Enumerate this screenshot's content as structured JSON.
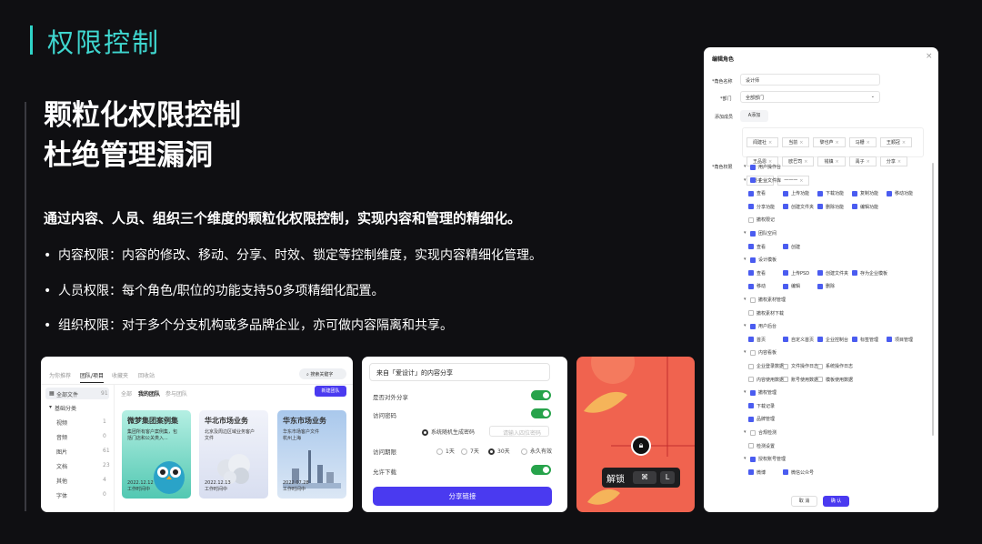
{
  "header": "权限控制",
  "headline": [
    "颗粒化权限控制",
    "杜绝管理漏洞"
  ],
  "intro": "通过内容、人员、组织三个维度的颗粒化权限控制，实现内容和管理的精细化。",
  "bullets": [
    "内容权限：内容的修改、移动、分享、时效、锁定等控制维度，实现内容精细化管理。",
    "人员权限：每个角色/职位的功能支持50多项精细化配置。",
    "组织权限：对于多个分支机构或多品牌企业，亦可做内容隔离和共享。"
  ],
  "bullet_dot": "•",
  "lib": {
    "tabs": [
      "为你推荐",
      "团队/项目",
      "收藏夹",
      "回收站"
    ],
    "search": "搜索关键字",
    "btn": "新建团队",
    "all": "全部文件",
    "all_count": "91",
    "tree_title": "基础分类",
    "tree": [
      {
        "l": "视频",
        "n": "1"
      },
      {
        "l": "音频",
        "n": "0"
      },
      {
        "l": "图片",
        "n": "61"
      },
      {
        "l": "文档",
        "n": "23"
      },
      {
        "l": "其他",
        "n": "4"
      },
      {
        "l": "字体",
        "n": "0"
      }
    ],
    "subtabs": [
      "全部",
      "我的团队",
      "参与团队"
    ],
    "cards": [
      {
        "t": "微梦集团案例集",
        "s": "集团所有客户案例集，包\n括门店和公关类入...",
        "d": "2022.12.12",
        "m": "工作时间中"
      },
      {
        "t": "华北市场业务",
        "s": "北京及周边区域业务客户\n文件",
        "d": "2022.12.13",
        "m": "工作时间中"
      },
      {
        "t": "华东市场业务",
        "s": "华东市场客户文件\n杭州上海",
        "d": "2022.07.28",
        "m": "工作时间中"
      }
    ]
  },
  "share": {
    "title": "来自「爱设计」的内容分享",
    "public": "是否对外分享",
    "pwd": "访问密码",
    "r1": "系统随机生成密码",
    "r2": "请输入四位密码",
    "period": "访问期限",
    "d": [
      "1天",
      "7天",
      "30天",
      "永久有效"
    ],
    "download": "允许下载",
    "btn": "分享链接"
  },
  "lock": {
    "label": "解锁",
    "k1": "⌘",
    "k2": "L"
  },
  "role": {
    "title": "编辑角色",
    "name_l": "*角色名称",
    "name_v": "设计师",
    "dept_l": "*部门",
    "dept_v": "全部部门",
    "add_l": "添加成员",
    "add_btn": "A添加",
    "members": [
      "闻建社",
      "当前",
      "黎也芦",
      "马栅",
      "王顺冠",
      "王品恩",
      "欧巴司",
      "钱镇",
      "禹子",
      "分享",
      "晏子",
      "一一一"
    ],
    "perm_l": "*角色权限",
    "rows": [
      {
        "lv": 0,
        "items": [
          "用户操作台"
        ]
      },
      {
        "lv": 0,
        "items": [
          "企业文件库"
        ]
      },
      {
        "lv": 1,
        "items": [
          "查看",
          "上传功能",
          "下载功能",
          "复制功能",
          "移动功能"
        ]
      },
      {
        "lv": 1,
        "items": [
          "分享功能",
          "创建文件夹",
          "删除功能",
          "编辑功能"
        ]
      },
      {
        "lv": 1,
        "items": [
          "撤权限记"
        ],
        "off": true
      },
      {
        "lv": 0,
        "items": [
          "团队空间"
        ]
      },
      {
        "lv": 1,
        "items": [
          "查看",
          "创建"
        ]
      },
      {
        "lv": 0,
        "items": [
          "设计模板"
        ]
      },
      {
        "lv": 1,
        "items": [
          "查看",
          "上传PSD",
          "创建文件夹",
          "存为企业模板"
        ]
      },
      {
        "lv": 1,
        "items": [
          "移动",
          "编辑",
          "删除"
        ]
      },
      {
        "lv": 0,
        "items": [
          "撤权素材管理"
        ],
        "off": true
      },
      {
        "lv": 1,
        "items": [
          "撤权素材下载"
        ],
        "off": true
      },
      {
        "lv": 0,
        "items": [
          "用户后台"
        ]
      },
      {
        "lv": 1,
        "items": [
          "首页",
          "自定义首页",
          "企业控制台",
          "标签管理",
          "项目管理"
        ]
      },
      {
        "lv": 0,
        "items": [
          "内容看板"
        ],
        "off": true
      },
      {
        "lv": 1,
        "items": [
          "企业登录数据",
          "文件操作日志",
          "系统操作日志"
        ],
        "off": true
      },
      {
        "lv": 1,
        "items": [
          "内容使用数据",
          "账号使用数据",
          "模板使用数据"
        ],
        "off": true
      },
      {
        "lv": 0,
        "items": [
          "撤权管理"
        ]
      },
      {
        "lv": 1,
        "items": [
          "下载记录"
        ]
      },
      {
        "lv": 1,
        "items": [
          "品牌管理"
        ]
      },
      {
        "lv": 0,
        "items": [
          "合规检测"
        ],
        "off": true
      },
      {
        "lv": 1,
        "items": [
          "检测设置"
        ],
        "off": true
      },
      {
        "lv": 0,
        "items": [
          "授权账号管理"
        ]
      },
      {
        "lv": 1,
        "items": [
          "微博",
          "微信公众号"
        ]
      }
    ],
    "cancel": "取 消",
    "ok": "确 认"
  },
  "colors": {
    "accent": "#3fd6cf",
    "brand": "#4a3af0"
  }
}
